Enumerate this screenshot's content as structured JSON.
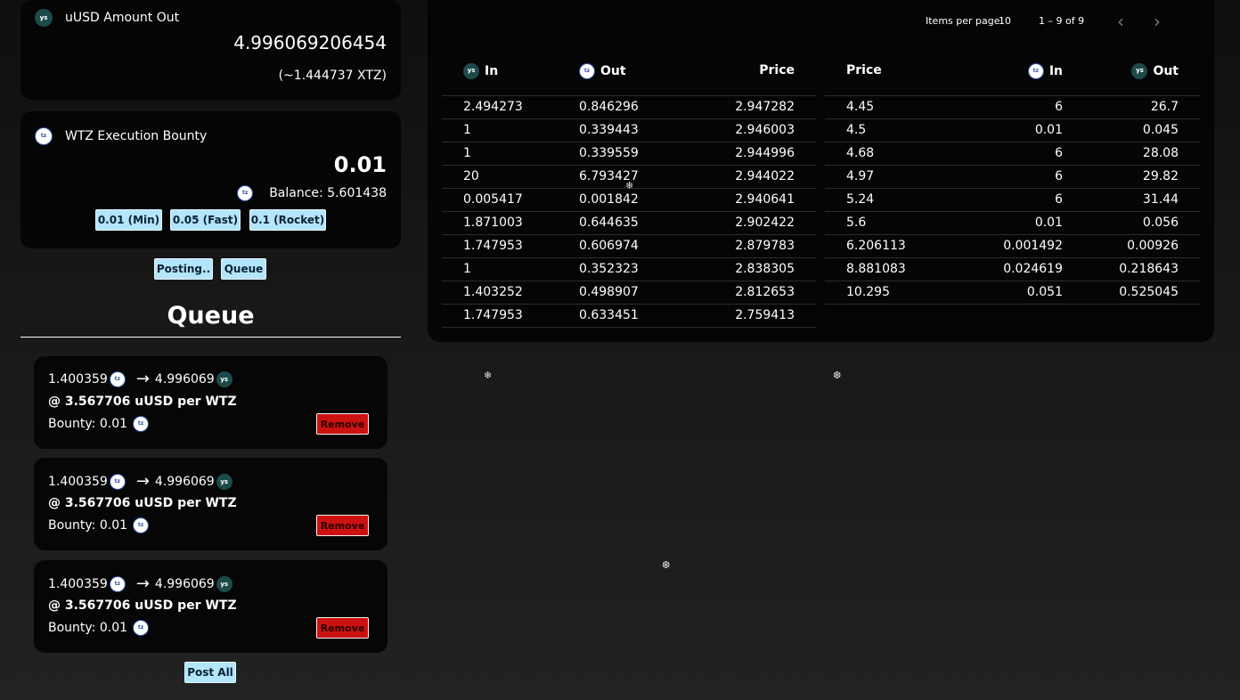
{
  "amount_out": {
    "label": "uUSD Amount Out",
    "icon": "uusd-icon",
    "value": "4.996069206454",
    "equivalent": "(~1.444737 XTZ)"
  },
  "bounty": {
    "label": "WTZ Execution Bounty",
    "icon": "wtz-icon",
    "value": "0.01",
    "balance_label": "Balance: 5.601438",
    "options": [
      "0.01 (Min)",
      "0.05 (Fast)",
      "0.1 (Rocket)"
    ]
  },
  "actions": {
    "posting_label": "Posting..",
    "queue_label": "Queue"
  },
  "queue": {
    "title": "Queue",
    "items": [
      {
        "amount_in": "1.400359",
        "amount_out": "4.996069",
        "rate": "@ 3.567706 uUSD per WTZ",
        "bounty": "Bounty: 0.01",
        "remove_label": "Remove"
      },
      {
        "amount_in": "1.400359",
        "amount_out": "4.996069",
        "rate": "@ 3.567706 uUSD per WTZ",
        "bounty": "Bounty: 0.01",
        "remove_label": "Remove"
      },
      {
        "amount_in": "1.400359",
        "amount_out": "4.996069",
        "rate": "@ 3.567706 uUSD per WTZ",
        "bounty": "Bounty: 0.01",
        "remove_label": "Remove"
      }
    ],
    "post_all_label": "Post All"
  },
  "paginator": {
    "items_per_page_label": "Items per page:",
    "items_per_page_value": "10",
    "range_label": "1 – 9 of 9",
    "prev_icon": "chevron-left-icon",
    "next_icon": "chevron-right-icon"
  },
  "left_table": {
    "headers": [
      "In",
      "Out",
      "Price"
    ],
    "header_icons": [
      "uusd-icon",
      "wtz-icon",
      ""
    ],
    "rows": [
      [
        "2.494273",
        "0.846296",
        "2.947282"
      ],
      [
        "1",
        "0.339443",
        "2.946003"
      ],
      [
        "1",
        "0.339559",
        "2.944996"
      ],
      [
        "20",
        "6.793427",
        "2.944022"
      ],
      [
        "0.005417",
        "0.001842",
        "2.940641"
      ],
      [
        "1.871003",
        "0.644635",
        "2.902422"
      ],
      [
        "1.747953",
        "0.606974",
        "2.879783"
      ],
      [
        "1",
        "0.352323",
        "2.838305"
      ],
      [
        "1.403252",
        "0.498907",
        "2.812653"
      ],
      [
        "1.747953",
        "0.633451",
        "2.759413"
      ]
    ]
  },
  "right_table": {
    "headers": [
      "Price",
      "In",
      "Out"
    ],
    "header_icons": [
      "",
      "wtz-icon",
      "uusd-icon"
    ],
    "rows": [
      [
        "4.45",
        "6",
        "26.7"
      ],
      [
        "4.5",
        "0.01",
        "0.045"
      ],
      [
        "4.68",
        "6",
        "28.08"
      ],
      [
        "4.97",
        "6",
        "29.82"
      ],
      [
        "5.24",
        "6",
        "31.44"
      ],
      [
        "5.6",
        "0.01",
        "0.056"
      ],
      [
        "6.206113",
        "0.001492",
        "0.00926"
      ],
      [
        "8.881083",
        "0.024619",
        "0.218643"
      ],
      [
        "10.295",
        "0.051",
        "0.525045"
      ]
    ]
  },
  "icons": {
    "uusd_text": "ys",
    "wtz_text": "tz"
  },
  "colors": {
    "pill_bg": "#b3e5fc",
    "remove_bg": "#cc1111",
    "uusd_icon_bg": "#1d4a4a",
    "wtz_icon_ring": "#2d4fa6"
  }
}
